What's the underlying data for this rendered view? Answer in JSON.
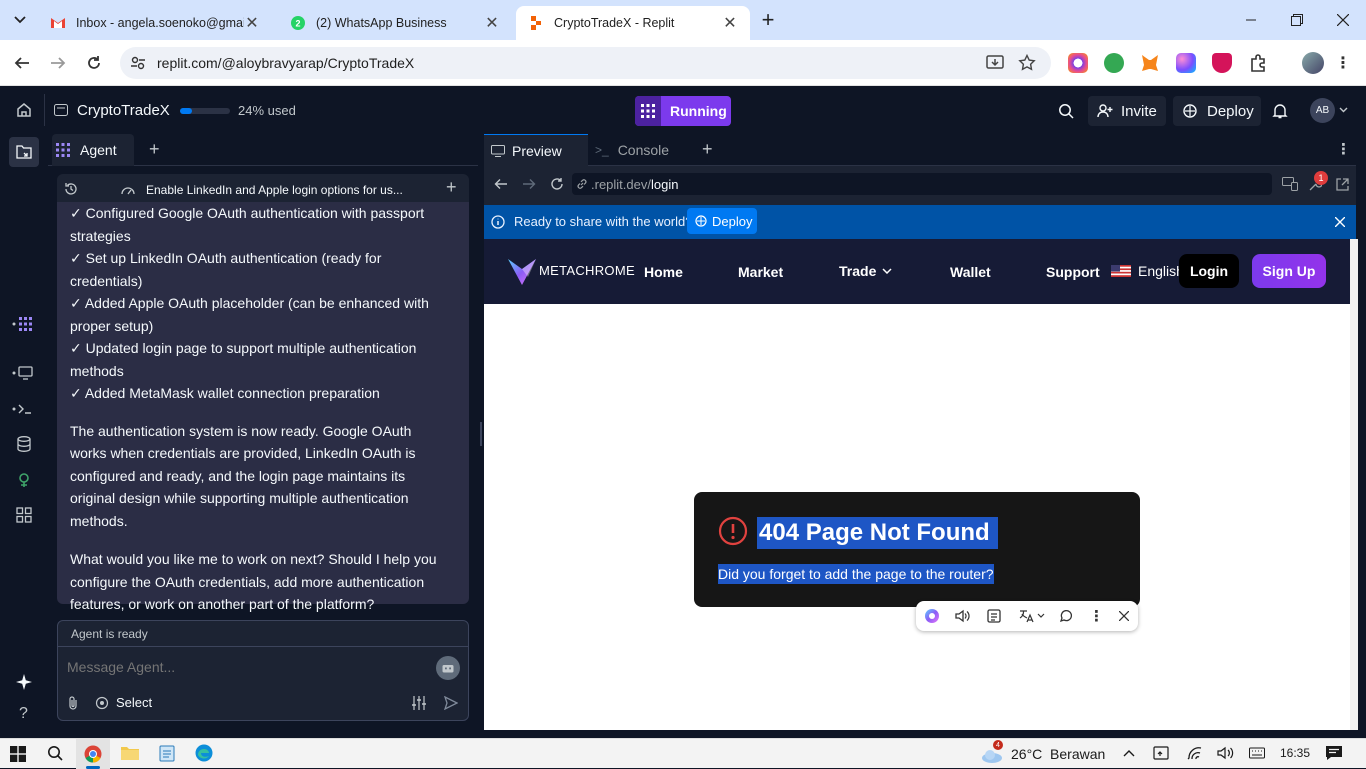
{
  "browser": {
    "tabs": [
      {
        "title": "Inbox - angela.soenoko@gmail.com"
      },
      {
        "title": "(2) WhatsApp Business"
      },
      {
        "title": "CryptoTradeX - Replit"
      }
    ],
    "url": "replit.com/@aloybravyarap/CryptoTradeX"
  },
  "replit": {
    "project_name": "CryptoTradeX",
    "usage_percent": 24,
    "usage_label": "24% used",
    "run_status": "Running",
    "invite_label": "Invite",
    "deploy_label": "Deploy",
    "avatar_initials": "AB",
    "agent_tab": "Agent",
    "task_title": "Enable LinkedIn and Apple login options for us...",
    "agent_items": [
      "✓ Configured Google OAuth authentication with passport strategies",
      "✓ Set up LinkedIn OAuth authentication (ready for credentials)",
      "✓ Added Apple OAuth placeholder (can be enhanced with proper setup)",
      "✓ Updated login page to support multiple authentication methods",
      "✓ Added MetaMask wallet connection preparation"
    ],
    "agent_para1": "The authentication system is now ready. Google OAuth works when credentials are provided, LinkedIn OAuth is configured and ready, and the login page maintains its original design while supporting multiple authentication methods.",
    "agent_para2": "What would you like me to work on next? Should I help you configure the OAuth credentials, add more authentication features, or work on another part of the platform?",
    "agent_status": "Agent is ready",
    "message_placeholder": "Message Agent...",
    "select_label": "Select",
    "preview_tab": "Preview",
    "console_tab": "Console",
    "preview_url_host": ".replit.dev/",
    "preview_url_path": "login",
    "notif_count": "1",
    "banner_text": "Ready to share with the world?",
    "banner_deploy": "Deploy"
  },
  "website": {
    "brand": "METACHROME",
    "nav": [
      "Home",
      "Market",
      "Trade",
      "Wallet",
      "Support"
    ],
    "language": "English",
    "login_label": "Login",
    "signup_label": "Sign Up",
    "error_title": "404 Page Not Found",
    "error_message": "Did you forget to add the page to the router?"
  },
  "taskbar": {
    "weather_badge": "4",
    "weather": "26°C  Berawan",
    "time": "16:35"
  },
  "colors": {
    "replit_bg": "#0e1525",
    "running": "#7c3aed",
    "banner": "#0053a6",
    "signup_gradient": "#7c3aed",
    "selection": "#1e56c5"
  }
}
